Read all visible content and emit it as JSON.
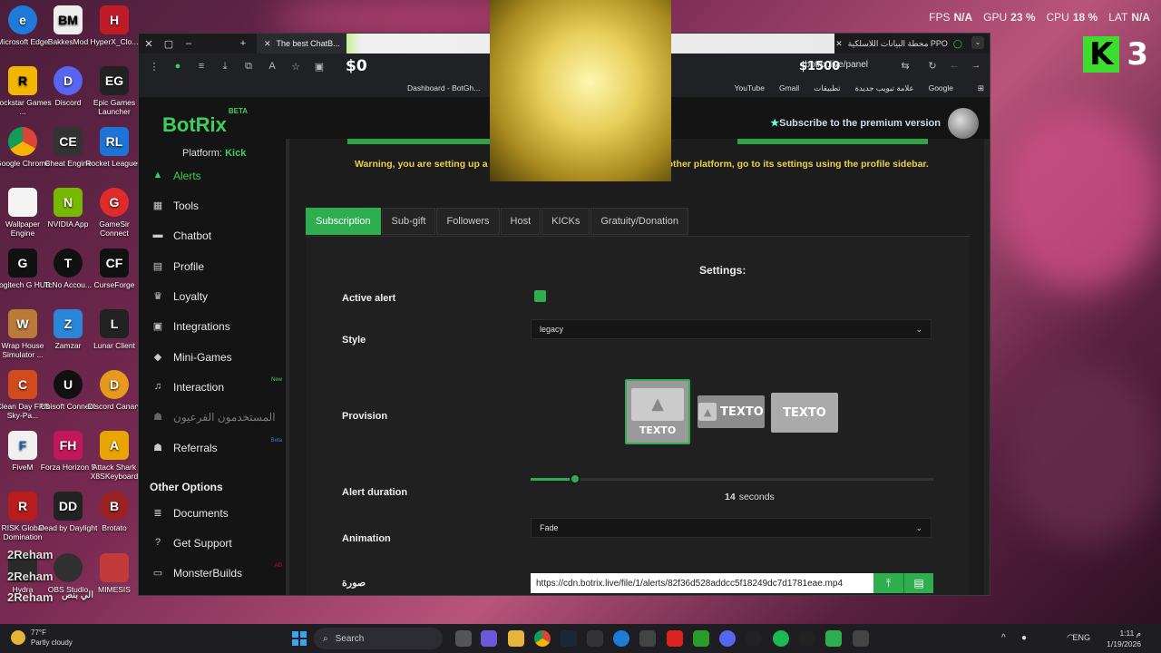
{
  "hud": {
    "fps_label": "FPS",
    "fps": "N/A",
    "gpu_label": "GPU",
    "gpu": "23 %",
    "cpu_label": "CPU",
    "cpu": "18 %",
    "lat_label": "LAT",
    "lat": "N/A"
  },
  "overlay_counter": {
    "k": "K",
    "number": "3"
  },
  "desktop_icons": [
    "Microsoft Edge",
    "BakkesMod",
    "HyperX_Clo...",
    "Rockstar Games ...",
    "Discord",
    "Epic Games Launcher",
    "Google Chrome",
    "Cheat Engine",
    "Rocket League®",
    "Wallpaper Engine",
    "NVIDIA App",
    "GameSir Connect",
    "Logitech G HUB",
    "TcNo Accou...",
    "CurseForge",
    "Wrap House Simulator ...",
    "Zamzar",
    "Lunar Client",
    "Clean Day FPS Sky-Pa...",
    "Ubisoft Connect",
    "Discord Canary",
    "FiveM",
    "Forza Horizon 5",
    "Attack Shark X8SKeyboard",
    "RISK Global Domination",
    "Dead by Daylight",
    "Brotato",
    "Hydra",
    "OBS Studio",
    "MIMESIS"
  ],
  "desktop_overlay_text": [
    "2Reham",
    "2Reham",
    "2Reham",
    "الي بنص"
  ],
  "browser": {
    "tab_title": "The best ChatB...",
    "tab_right": "محطة البيانات اللاسلكية PPO",
    "money_left": "$0",
    "money_right": "$1500",
    "url": "botrix.live/panel",
    "bookmark_left": "Dashboard - BotGh...",
    "bookmarks": [
      "YouTube",
      "Gmail",
      "تطبيقات",
      "علامة تبويب جديدة",
      "Google"
    ]
  },
  "site": {
    "brand": "BotRix",
    "brand_badge": "BETA",
    "premium": "Subscribe to the premium version",
    "platform_label": "Platform:",
    "platform": "Kick"
  },
  "sidebar": {
    "items": [
      {
        "label": "Alerts",
        "icon": "warning-icon"
      },
      {
        "label": "Tools",
        "icon": "grid-icon"
      },
      {
        "label": "Chatbot",
        "icon": "chat-icon"
      },
      {
        "label": "Profile",
        "icon": "id-card-icon"
      },
      {
        "label": "Loyalty",
        "icon": "trophy-icon"
      },
      {
        "label": "Integrations",
        "icon": "window-icon"
      },
      {
        "label": "Mini-Games",
        "icon": "gamepad-icon"
      },
      {
        "label": "Interaction",
        "icon": "music-icon",
        "badge": "New"
      },
      {
        "label": "المستخدمون الفرعيون",
        "icon": "users-icon"
      },
      {
        "label": "Referrals",
        "icon": "group-icon",
        "badge": "Beta"
      }
    ],
    "other_options": "Other Options",
    "other_items": [
      {
        "label": "Documents",
        "icon": "list-icon"
      },
      {
        "label": "Get Support",
        "icon": "question-icon"
      },
      {
        "label": "MonsterBuilds",
        "icon": "monitor-icon",
        "badge": "AD"
      }
    ]
  },
  "main": {
    "warning_left": "Warning, you are setting up a",
    "warning_right": "other platform, go to its settings using the profile sidebar.",
    "tabs": [
      "Subscription",
      "Sub-gift",
      "Followers",
      "Host",
      "KICKs",
      "Gratuity/Donation"
    ],
    "settings_title": "Settings:",
    "active_alert_label": "Active alert",
    "style_label": "Style",
    "style_value": "legacy",
    "provision_label": "Provision",
    "provision_text": "TEXTO",
    "alert_duration_label": "Alert duration",
    "alert_duration_value": "14",
    "alert_duration_unit": "seconds",
    "alert_duration_fraction": 0.11,
    "animation_label": "Animation",
    "animation_value": "Fade",
    "image_label": "صورة",
    "image_url": "https://cdn.botrix.live/file/1/alerts/82f36d528addcc5f18249dc7d1781eae.mp4"
  },
  "taskbar": {
    "temp": "77°F",
    "weather": "Partly cloudy",
    "search": "Search",
    "lang": "ENG",
    "time": "م 1:11",
    "date": "1/19/2026"
  }
}
